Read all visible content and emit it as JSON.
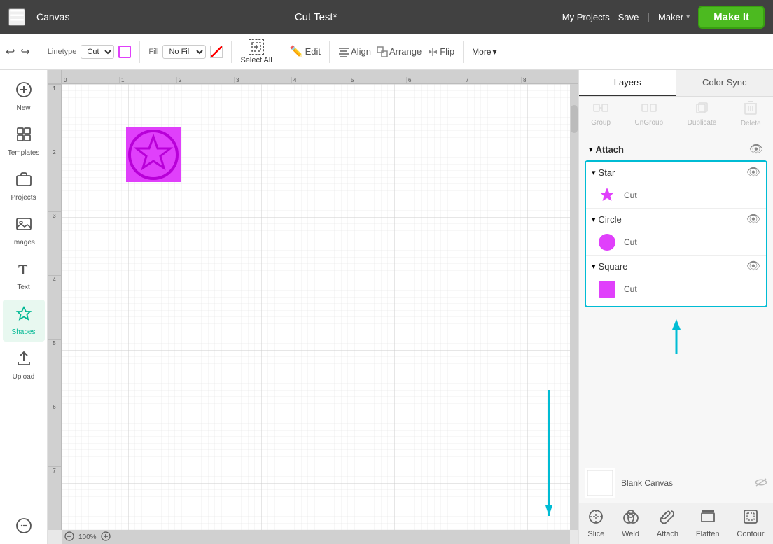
{
  "header": {
    "menu_label": "☰",
    "canvas_label": "Canvas",
    "title": "Cut Test*",
    "my_projects": "My Projects",
    "save": "Save",
    "divider": "|",
    "maker": "Maker",
    "make_it": "Make It"
  },
  "toolbar": {
    "linetype_label": "Linetype",
    "linetype_value": "Cut",
    "fill_label": "Fill",
    "fill_value": "No Fill",
    "select_all_label": "Select All",
    "edit_label": "Edit",
    "align_label": "Align",
    "arrange_label": "Arrange",
    "flip_label": "Flip",
    "more_label": "More",
    "more_arrow": "▾"
  },
  "sidebar": {
    "items": [
      {
        "id": "new",
        "label": "New",
        "icon": "+"
      },
      {
        "id": "templates",
        "label": "Templates",
        "icon": "⊞"
      },
      {
        "id": "projects",
        "label": "Projects",
        "icon": "🗂"
      },
      {
        "id": "images",
        "label": "Images",
        "icon": "🖼"
      },
      {
        "id": "text",
        "label": "Text",
        "icon": "T"
      },
      {
        "id": "shapes",
        "label": "Shapes",
        "icon": "⭐"
      },
      {
        "id": "upload",
        "label": "Upload",
        "icon": "⬆"
      }
    ]
  },
  "ruler": {
    "h_marks": [
      "0",
      "1",
      "2",
      "3",
      "4",
      "5",
      "6",
      "7",
      "8"
    ],
    "v_marks": [
      "1",
      "2",
      "3",
      "4",
      "5",
      "6",
      "7"
    ]
  },
  "zoom": {
    "minus_label": "−",
    "value": "100%",
    "plus_label": "+"
  },
  "right_panel": {
    "tabs": [
      {
        "id": "layers",
        "label": "Layers"
      },
      {
        "id": "color_sync",
        "label": "Color Sync"
      }
    ],
    "toolbar": {
      "group_label": "Group",
      "ungroup_label": "UnGroup",
      "duplicate_label": "Duplicate",
      "delete_label": "Delete"
    },
    "layers": {
      "attach_group": {
        "name": "Attach",
        "items": [
          {
            "name": "Star",
            "sub_items": [
              {
                "label": "Cut",
                "color": "#e040fb",
                "type": "star"
              }
            ]
          },
          {
            "name": "Circle",
            "sub_items": [
              {
                "label": "Cut",
                "color": "#e040fb",
                "type": "circle"
              }
            ]
          },
          {
            "name": "Square",
            "sub_items": [
              {
                "label": "Cut",
                "color": "#e040fb",
                "type": "square"
              }
            ]
          }
        ]
      }
    },
    "canvas_preview": {
      "label": "Blank Canvas",
      "thumb_bg": "#fff"
    },
    "bottom_actions": [
      {
        "id": "slice",
        "label": "Slice",
        "icon": "✂"
      },
      {
        "id": "weld",
        "label": "Weld",
        "icon": "⬡"
      },
      {
        "id": "attach",
        "label": "Attach",
        "icon": "📎"
      },
      {
        "id": "flatten",
        "label": "Flatten",
        "icon": "⬜"
      },
      {
        "id": "contour",
        "label": "Contour",
        "icon": "◻"
      }
    ]
  },
  "colors": {
    "accent_teal": "#00bcd4",
    "accent_green": "#4cba20",
    "pink_magenta": "#e040fb",
    "header_bg": "#414141",
    "active_sidebar_bg": "#e8f8f0"
  }
}
